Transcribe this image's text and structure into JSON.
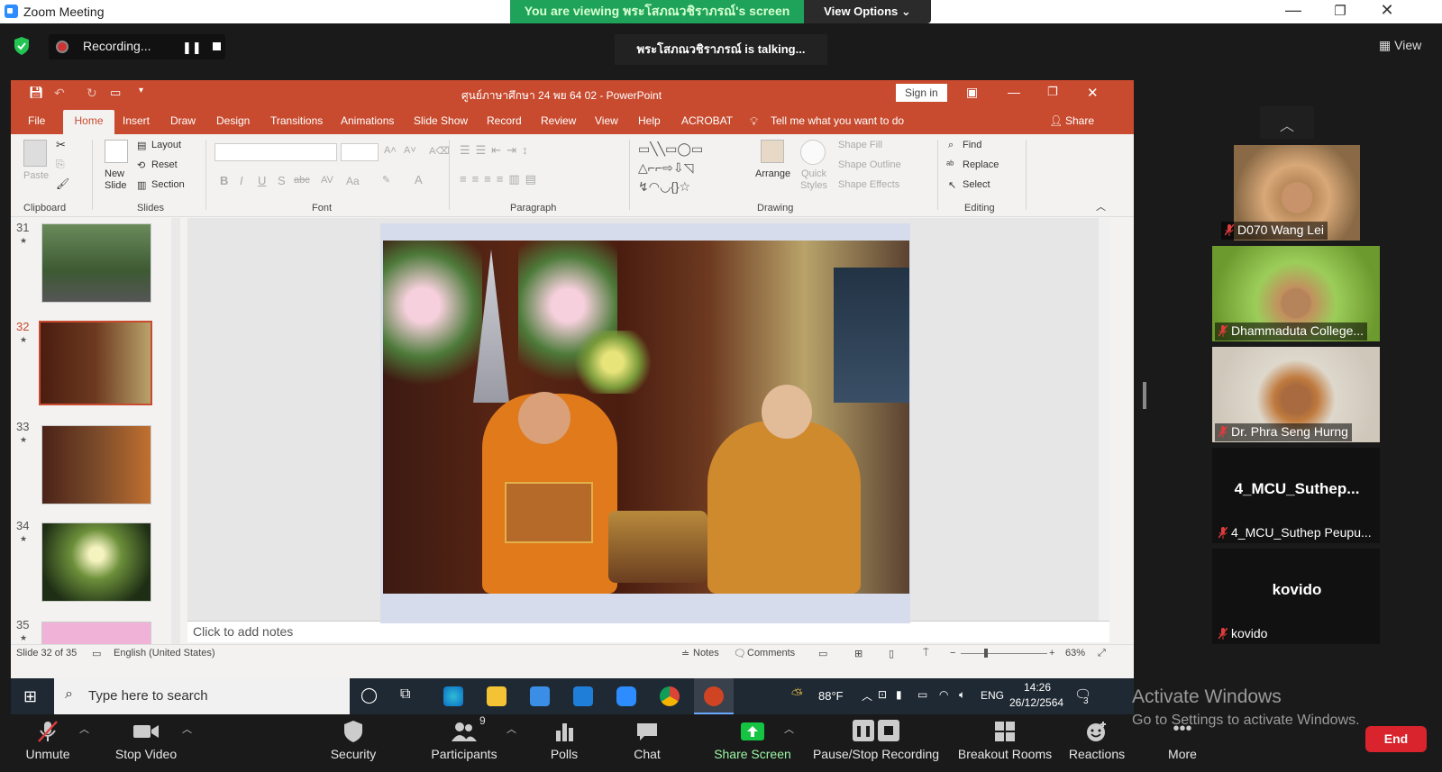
{
  "zoom": {
    "title": "Zoom Meeting",
    "viewing": "You are viewing พระโสภณวชิราภรณ์'s screen",
    "view_options": "View Options",
    "recording": "Recording...",
    "talking": "พระโสภณวชิราภรณ์ is  talking...",
    "view": "View",
    "window_controls": [
      "—",
      "❐",
      "✕"
    ]
  },
  "ppt": {
    "title": "ศูนย์ภาษาศึกษา 24 พย 64 02  -  PowerPoint",
    "sign_in": "Sign in",
    "tabs": [
      "File",
      "Home",
      "Insert",
      "Draw",
      "Design",
      "Transitions",
      "Animations",
      "Slide Show",
      "Record",
      "Review",
      "View",
      "Help",
      "ACROBAT"
    ],
    "tell_me": "Tell me what you want to do",
    "share": "Share",
    "ribbon": {
      "clipboard": {
        "label": "Clipboard",
        "paste": "Paste"
      },
      "slides": {
        "label": "Slides",
        "new_slide": "New Slide",
        "layout": "Layout",
        "reset": "Reset",
        "section": "Section"
      },
      "font": {
        "label": "Font",
        "buttons": [
          "B",
          "I",
          "U",
          "S",
          "abc",
          "AV",
          "Aa",
          "A"
        ]
      },
      "paragraph": {
        "label": "Paragraph"
      },
      "drawing": {
        "label": "Drawing",
        "arrange": "Arrange",
        "quick_styles": "Quick Styles",
        "shape_fill": "Shape Fill",
        "shape_outline": "Shape Outline",
        "shape_effects": "Shape Effects"
      },
      "editing": {
        "label": "Editing",
        "find": "Find",
        "replace": "Replace",
        "select": "Select"
      }
    },
    "slides": [
      {
        "num": "31"
      },
      {
        "num": "32"
      },
      {
        "num": "33"
      },
      {
        "num": "34"
      },
      {
        "num": "35"
      }
    ],
    "notes_placeholder": "Click to add notes",
    "status": {
      "slide": "Slide 32 of 35",
      "language": "English (United States)",
      "notes": "Notes",
      "comments": "Comments",
      "zoom": "63%"
    }
  },
  "taskbar": {
    "search_placeholder": "Type here to search",
    "weather": "88°F",
    "lang": "ENG",
    "time": "14:26",
    "date": "26/12/2564",
    "notif_count": "3"
  },
  "participants": [
    {
      "name": "D070 Wang Lei",
      "video": true
    },
    {
      "name": "Dhammaduta College...",
      "video": true
    },
    {
      "name": "Dr. Phra Seng Hurng",
      "video": true
    },
    {
      "name": "4_MCU_Suthep Peupu...",
      "display": "4_MCU_Suthep...",
      "video": false
    },
    {
      "name": "kovido",
      "display": "kovido",
      "video": false
    }
  ],
  "activate": {
    "line1": "Activate Windows",
    "line2": "Go to Settings to activate Windows."
  },
  "toolbar": {
    "unmute": "Unmute",
    "stop_video": "Stop Video",
    "security": "Security",
    "participants": "Participants",
    "participants_count": "9",
    "polls": "Polls",
    "chat": "Chat",
    "share_screen": "Share Screen",
    "pause_stop_recording": "Pause/Stop Recording",
    "breakout_rooms": "Breakout Rooms",
    "reactions": "Reactions",
    "more": "More",
    "end": "End"
  },
  "colors": {
    "ppt_accent": "#c84b2f",
    "viewing_banner": "#1fa35b",
    "share_green": "#16c443",
    "end_red": "#d9232d"
  }
}
